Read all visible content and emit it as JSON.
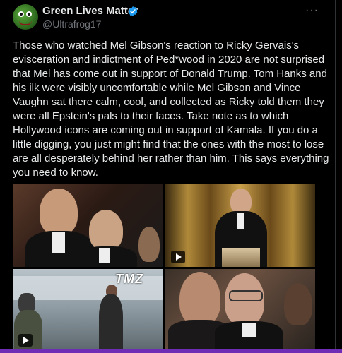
{
  "author": {
    "display_name": "Green Lives Matter",
    "handle": "@Ultrafrog17"
  },
  "menu": {
    "more_label": "···"
  },
  "tweet": {
    "text": "Those who watched Mel Gibson's reaction to Ricky Gervais's evisceration and indictment of Ped*wood in 2020 are not surprised that Mel has come out in support of Donald Trump. Tom Hanks and his ilk were visibly uncomfortable while Mel Gibson and Vince Vaughn sat there calm, cool, and collected as Ricky told them they were all Epstein's pals to their faces. Take note as to which Hollywood icons are coming out in support of Kamala. If you do a little digging, you just might find that the ones with the most to lose are all desperately behind her rather than him. This says everything you need to know."
  },
  "media": {
    "watermark": "TMZ",
    "items": [
      {
        "icon": "photo",
        "video": false
      },
      {
        "icon": "play-icon",
        "video": true
      },
      {
        "icon": "play-icon",
        "video": true
      },
      {
        "icon": "photo",
        "video": false
      }
    ]
  },
  "colors": {
    "background": "#000000",
    "text": "#e7e9ea",
    "secondary": "#71767b",
    "verified": "#1d9bf0",
    "accent_bar": "#6f2db5"
  }
}
